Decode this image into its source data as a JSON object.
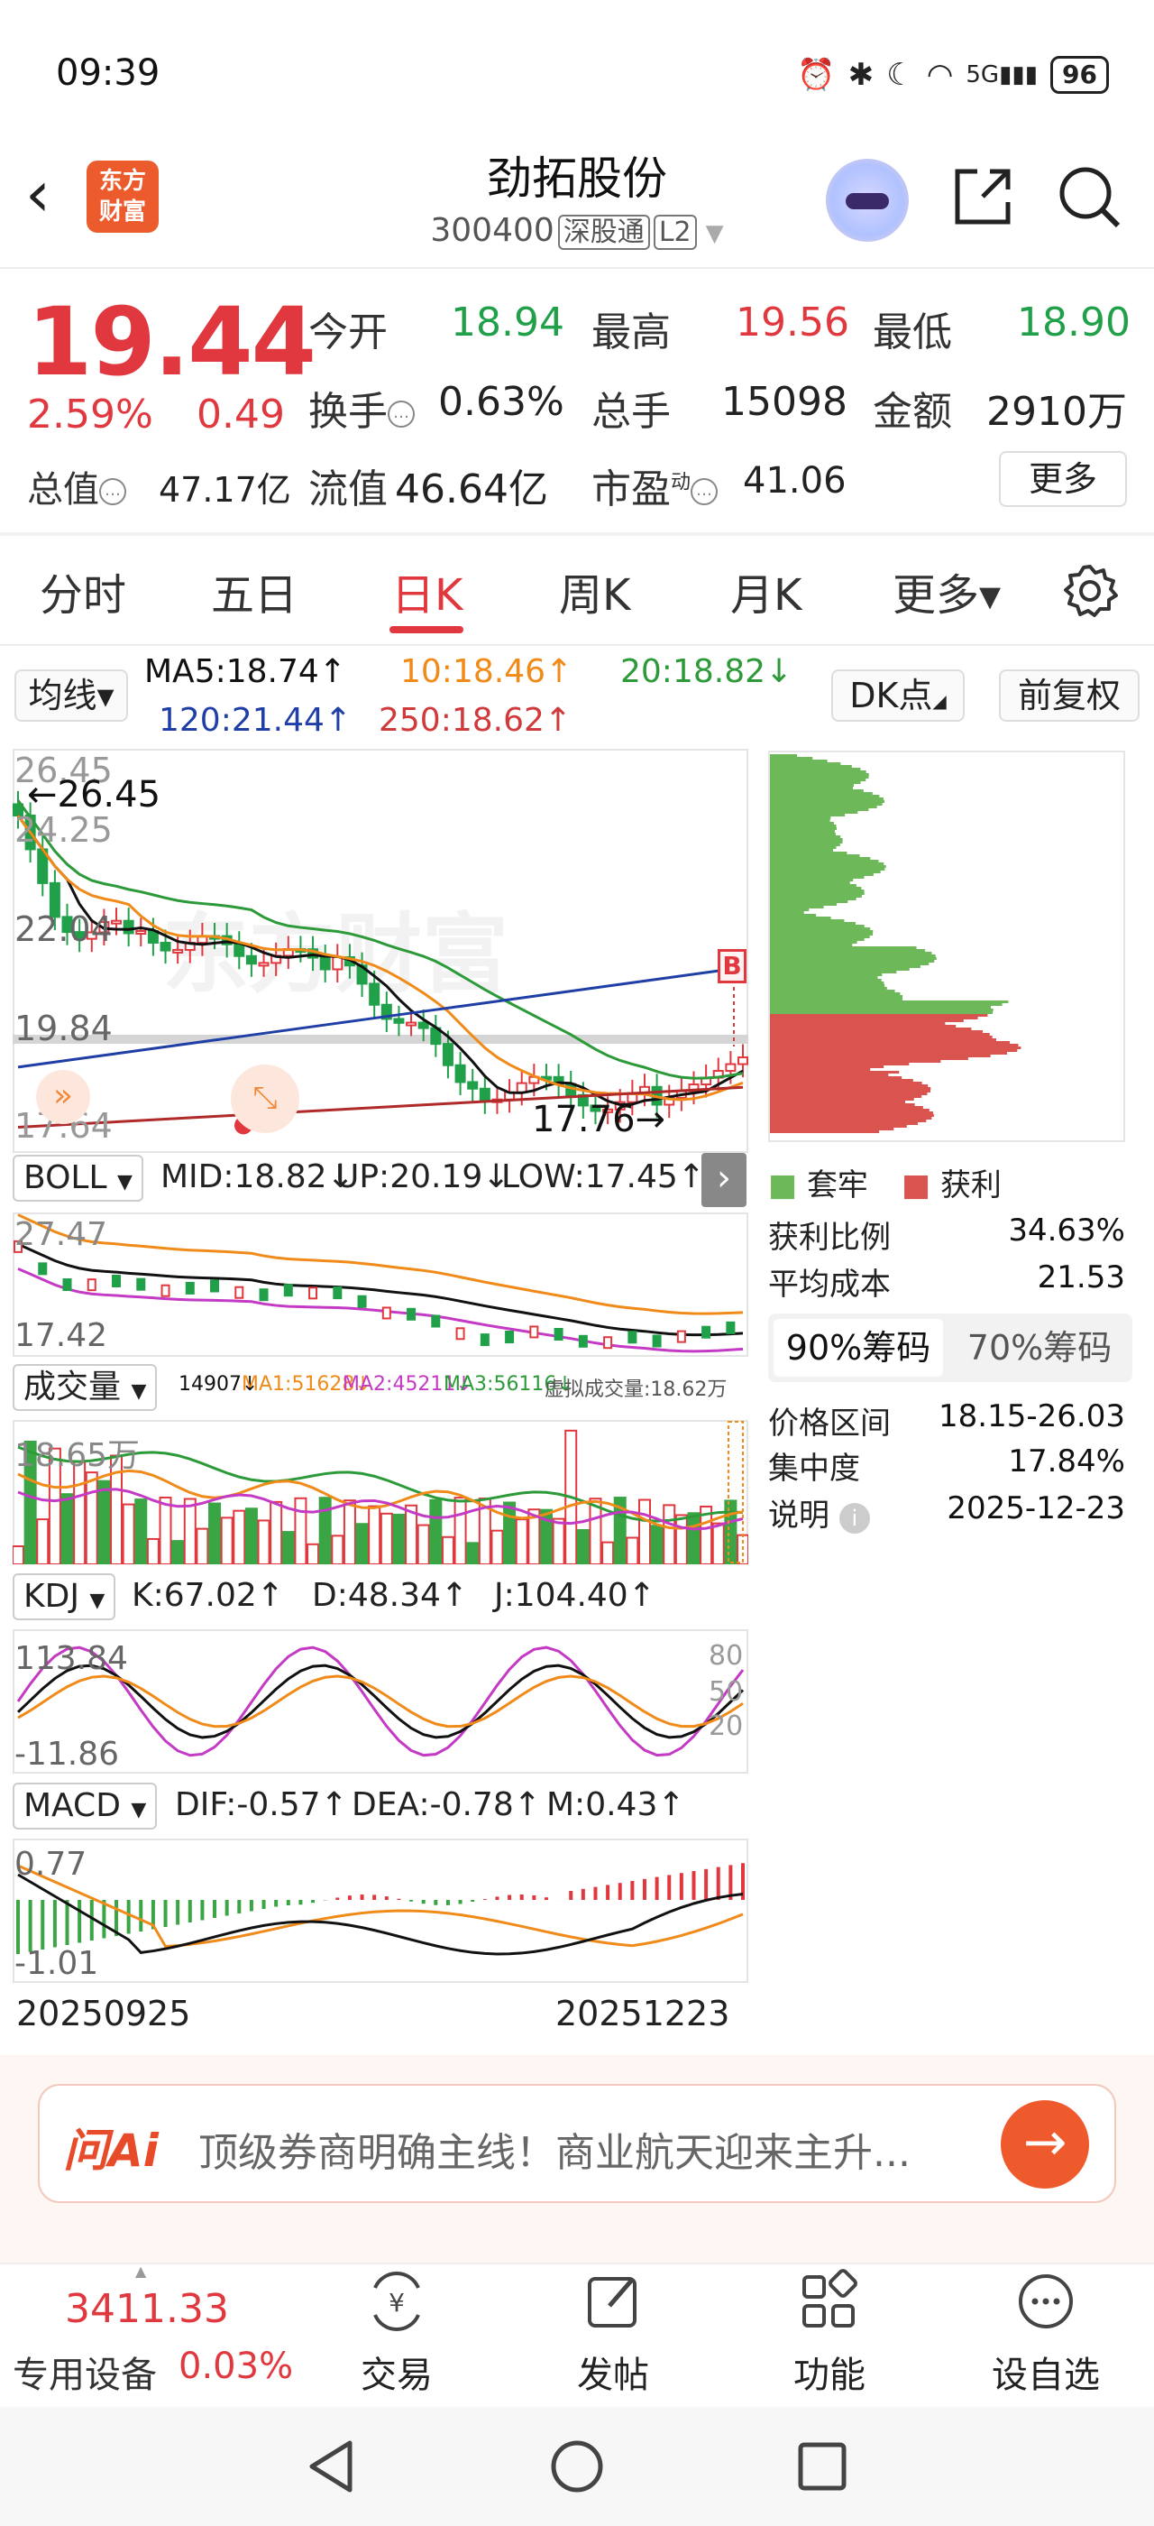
{
  "status_bar": {
    "time": "09:39",
    "battery": "96",
    "network": "5G"
  },
  "header": {
    "stock_name": "劲拓股份",
    "stock_code": "300400",
    "tag_connect": "深股通",
    "tag_level": "L2",
    "logo_line1": "东方",
    "logo_line2": "财富"
  },
  "quote": {
    "price": "19.44",
    "change_pct": "2.59%",
    "change_amt": "0.49",
    "open_label": "今开",
    "open": "18.94",
    "high_label": "最高",
    "high": "19.56",
    "low_label": "最低",
    "low": "18.90",
    "turnover_label": "换手",
    "turnover": "0.63%",
    "volume_label": "总手",
    "volume": "15098",
    "amount_label": "金额",
    "amount": "2910万",
    "mktcap_label": "总值",
    "mktcap": "47.17亿",
    "float_label": "流值",
    "float": "46.64亿",
    "pe_label": "市盈",
    "pe_sup": "动",
    "pe": "41.06",
    "more_label": "更多"
  },
  "tabs": [
    {
      "label": "分时"
    },
    {
      "label": "五日"
    },
    {
      "label": "日K"
    },
    {
      "label": "周K"
    },
    {
      "label": "月K"
    },
    {
      "label": "更多▾"
    }
  ],
  "ma_row": {
    "selector": "均线",
    "ma5": "MA5:18.74↑",
    "ma10": "10:18.46↑",
    "ma20": "20:18.82↓",
    "ma120": "120:21.44↑",
    "ma250": "250:18.62↑",
    "dk_label": "DK点",
    "adj_label": "前复权"
  },
  "kline": {
    "y_top": "26.45",
    "y_mid_upper": "24.25",
    "y_mid": "22.04",
    "y_mid_lower": "19.84",
    "y_bottom": "17.64",
    "max_mark": "←26.45",
    "min_mark": "17.76→",
    "watermark": "东方财富",
    "b_mark": "B",
    "colors": {
      "up": "#e0383e",
      "down": "#21a04a",
      "ma5": "#111111",
      "ma10": "#f08a19",
      "ma20": "#2d9a3a",
      "ma120": "#1f3fa6",
      "ma250": "#b02a2a"
    }
  },
  "chip": {
    "legend_trapped": "套牢",
    "legend_profit": "获利",
    "profit_ratio_label": "获利比例",
    "profit_ratio": "34.63%",
    "avg_cost_label": "平均成本",
    "avg_cost": "21.53",
    "tab_90": "90%筹码",
    "tab_70": "70%筹码",
    "range_label": "价格区间",
    "range": "18.15-26.03",
    "concentration_label": "集中度",
    "concentration": "17.84%",
    "note_label": "说明",
    "note": "2025-12-23"
  },
  "boll": {
    "selector": "BOLL",
    "mid": "MID:18.82↓",
    "up": "UP:20.19↓",
    "low": "LOW:17.45↑",
    "y_top": "27.47",
    "y_bottom": "17.42"
  },
  "volume": {
    "selector": "成交量",
    "vol": "14907↓",
    "ma1": "MA1:51628↓",
    "ma2": "MA2:45211↓",
    "ma3": "MA3:56116↓",
    "virtual": "虚拟成交量:18.62万",
    "y_top": "18.65万"
  },
  "kdj": {
    "selector": "KDJ",
    "k": "K:67.02↑",
    "d": "D:48.34↑",
    "j": "J:104.40↑",
    "y_top": "113.84",
    "y_bottom": "-11.86",
    "lvl80": "80",
    "lvl50": "50",
    "lvl20": "20"
  },
  "macd": {
    "selector": "MACD",
    "dif": "DIF:-0.57↑",
    "dea": "DEA:-0.78↑",
    "m": "M:0.43↑",
    "y_top": "0.77",
    "y_bottom": "-1.01"
  },
  "dates": {
    "start": "20250925",
    "end": "20251223"
  },
  "ai": {
    "logo": "问Ai",
    "text": "顶级券商明确主线！商业航天迎来主升..."
  },
  "bottom": {
    "index_value": "3411.33",
    "index_name": "专用设备",
    "index_pct": "0.03%",
    "nav": [
      {
        "label": "交易"
      },
      {
        "label": "发帖"
      },
      {
        "label": "功能"
      },
      {
        "label": "设自选"
      }
    ]
  }
}
